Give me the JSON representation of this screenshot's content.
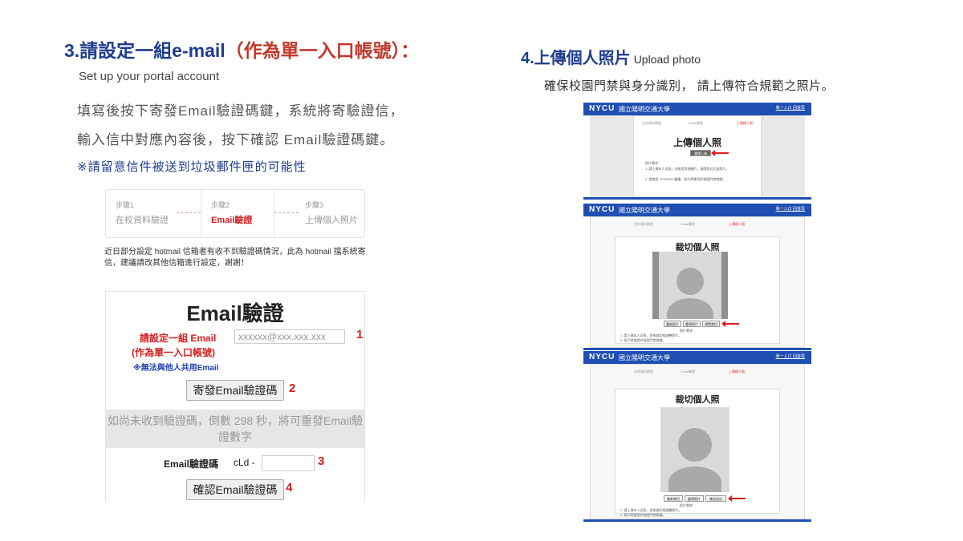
{
  "left": {
    "heading_prefix": "3.請設定一組e-mail",
    "heading_paren": "（作為單一入口帳號）：",
    "subtitle_en": "Set up your portal account",
    "desc_line1": "填寫後按下寄發Email驗證碼鍵，系統將寄驗證信，",
    "desc_line2": "輸入信中對應內容後，按下確認 Email驗證碼鍵。",
    "note": "※請留意信件被送到垃圾郵件匣的可能性",
    "steps": [
      {
        "num": "步驟1",
        "label": "在校資料驗證"
      },
      {
        "num": "步驟2",
        "label": "Email驗證"
      },
      {
        "num": "步驟3",
        "label": "上傳個人照片"
      }
    ],
    "hotmail_notice": "近日部分設定 hotmail 信箱者有收不到驗證碼情況，此為 hotmail 擋系統寄信，建議請改其他信箱進行設定，謝謝！",
    "form": {
      "title": "Email驗證",
      "email_label": "請設定一組 Email",
      "email_label2": "(作為單一入口帳號)",
      "email_label3": "※無法與他人共用Email",
      "email_placeholder": "xxxxxx@xxx.xxx.xxx",
      "send_button": "寄發Email驗證碼",
      "countdown": "如尚未收到驗證碼，倒數 298 秒，將可重發Email驗證數字",
      "code_label": "Email驗證碼",
      "code_prefix": "cLd -",
      "code_value": "",
      "confirm_button": "確認Email驗證碼",
      "markers": [
        "1",
        "2",
        "3",
        "4"
      ]
    }
  },
  "right": {
    "heading": "4.上傳個人照片",
    "heading_en": "Upload photo",
    "desc": "確保校園門禁與身分識別， 請上傳符合規範之照片。",
    "brand_logo": "NYCU",
    "brand_name": "國立陽明交通大學",
    "top_links": "單一入口  回首頁",
    "mini_steps": [
      "在校資料驗證",
      "Email驗證",
      "上傳個人照"
    ],
    "shot1": {
      "title": "上傳個人照",
      "upload_button": "選擇上傳",
      "hint_title": "照片需求：",
      "hint1": "1. 請上傳本人近照，勿使用其他圖片，須證照式正面照片。",
      "hint2": "2. 請使用 JPG/PNG 圖檔，照片將使用於校園門禁辨識。"
    },
    "shot2": {
      "title": "裁切個人照",
      "buttons": [
        "重新照片",
        "重傳照片",
        "預覽裁切"
      ],
      "hint_title": "照片需求：",
      "hint1": "1. 請上傳本人近照，並依裁切框調整照片。",
      "hint2": "2. 照片將使用於校園門禁辨識。"
    },
    "shot3": {
      "title": "裁切個人照",
      "buttons": [
        "重新裁切",
        "重傳照片",
        "確認送出"
      ],
      "hint_title": "照片需求：",
      "hint1": "1. 請上傳本人近照，並依裁切框調整照片。",
      "hint2": "2. 照片將使用於校園門禁辨識。"
    }
  },
  "colors": {
    "heading_blue": "#1f3d8f",
    "accent_red": "#d61f1f",
    "nycu_blue": "#1f4fb3"
  }
}
